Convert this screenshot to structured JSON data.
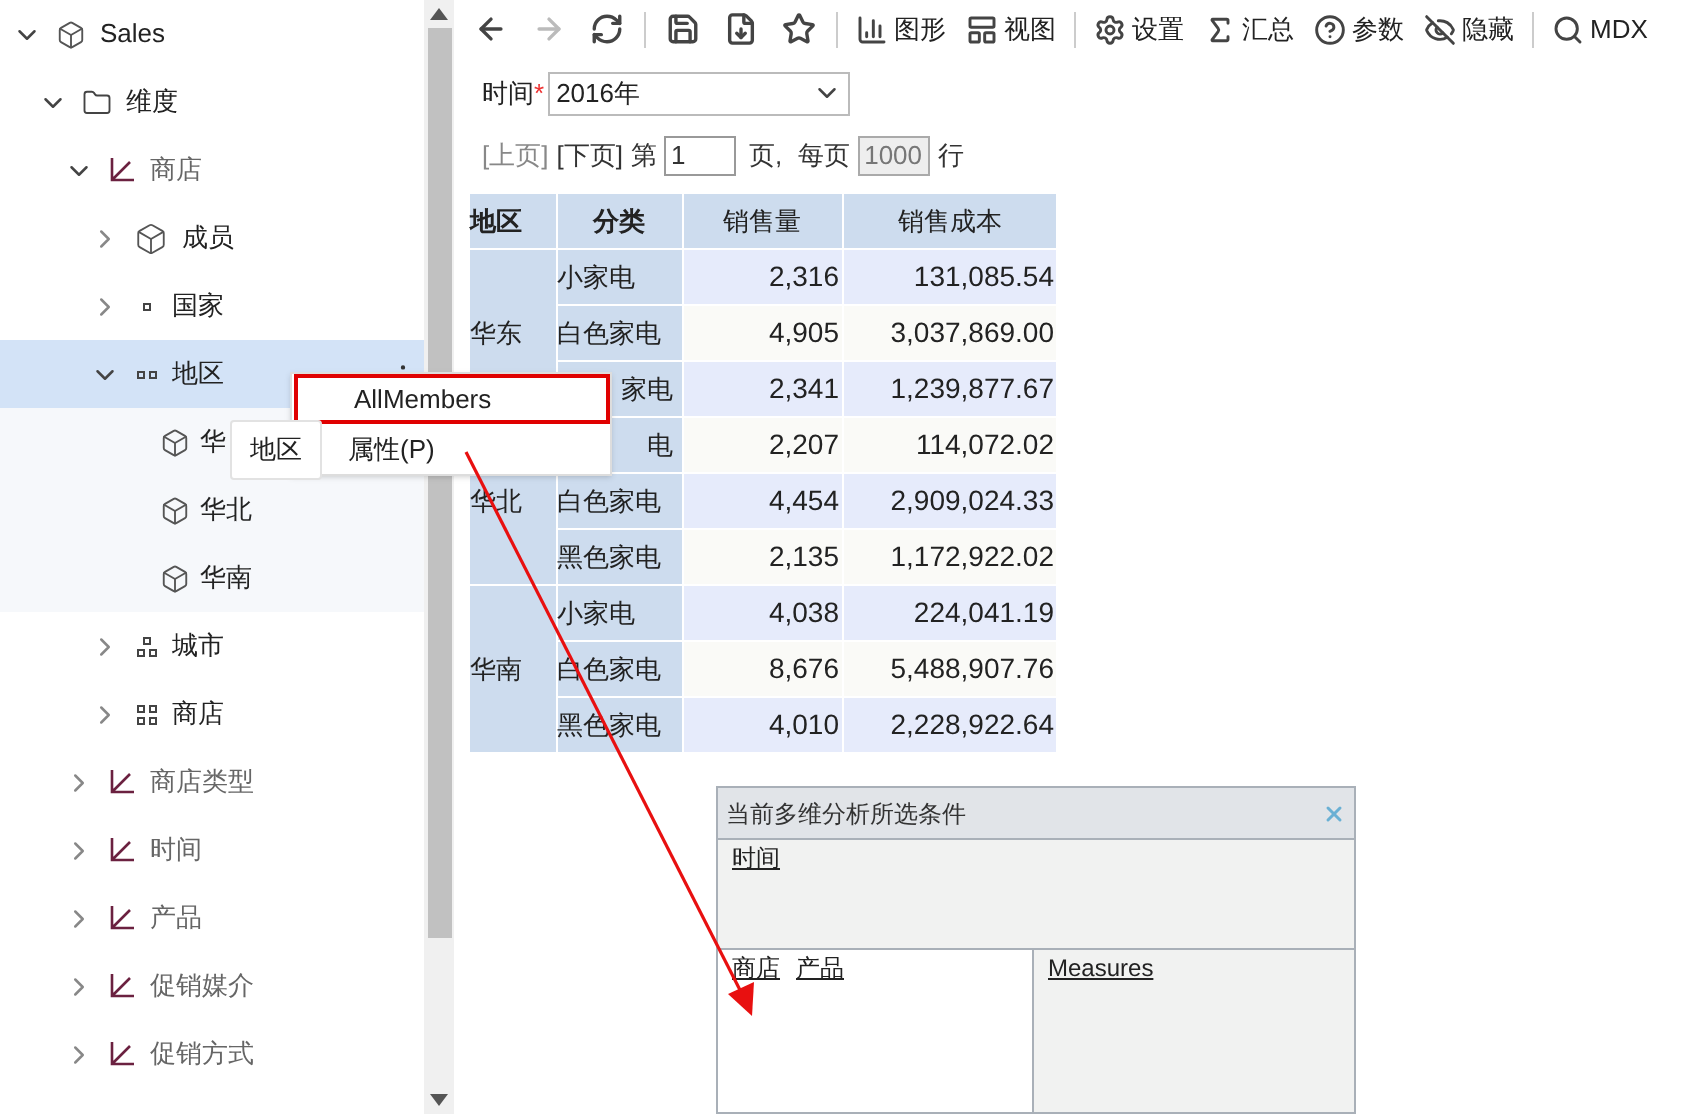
{
  "tree": [
    {
      "label": "Sales",
      "kind": "cube",
      "expanded": true,
      "children": [
        {
          "label": "维度",
          "kind": "folder",
          "expanded": true,
          "children": [
            {
              "label": "商店",
              "kind": "dimension",
              "expanded": true,
              "children": [
                {
                  "label": "成员",
                  "kind": "members",
                  "expanded": false
                },
                {
                  "label": "国家",
                  "kind": "level1",
                  "expanded": false
                },
                {
                  "label": "地区",
                  "kind": "level2",
                  "expanded": true,
                  "selected": true,
                  "children": [
                    {
                      "label": "华",
                      "kind": "member"
                    },
                    {
                      "label": "华北",
                      "kind": "member"
                    },
                    {
                      "label": "华南",
                      "kind": "member"
                    }
                  ]
                },
                {
                  "label": "城市",
                  "kind": "level3",
                  "expanded": false
                },
                {
                  "label": "商店",
                  "kind": "level4",
                  "expanded": false
                }
              ]
            },
            {
              "label": "商店类型",
              "kind": "dimension",
              "expanded": false
            },
            {
              "label": "时间",
              "kind": "dimension",
              "expanded": false
            },
            {
              "label": "产品",
              "kind": "dimension",
              "expanded": false
            },
            {
              "label": "促销媒介",
              "kind": "dimension",
              "expanded": false
            },
            {
              "label": "促销方式",
              "kind": "dimension",
              "expanded": false
            }
          ]
        }
      ]
    }
  ],
  "context_menu": {
    "items": [
      {
        "label": "AllMembers",
        "selected": true
      },
      {
        "label": "属性(P)",
        "selected": false
      }
    ],
    "tooltip": "地区"
  },
  "toolbar": [
    {
      "kind": "back",
      "disabled": false
    },
    {
      "kind": "forward",
      "disabled": true
    },
    {
      "kind": "refresh",
      "disabled": false
    },
    {
      "kind": "sep"
    },
    {
      "kind": "save",
      "disabled": false
    },
    {
      "kind": "saveas",
      "disabled": false
    },
    {
      "kind": "star",
      "disabled": false
    },
    {
      "kind": "sep"
    },
    {
      "kind": "chart",
      "label": "图形",
      "disabled": false
    },
    {
      "kind": "view",
      "label": "视图",
      "disabled": false
    },
    {
      "kind": "sep"
    },
    {
      "kind": "settings",
      "label": "设置",
      "disabled": false
    },
    {
      "kind": "sum",
      "label": "汇总",
      "disabled": false
    },
    {
      "kind": "help",
      "label": "参数",
      "disabled": false
    },
    {
      "kind": "hide",
      "label": "隐藏",
      "disabled": false
    },
    {
      "kind": "sep"
    },
    {
      "kind": "search",
      "label": "MDX",
      "disabled": false
    }
  ],
  "filter": {
    "label": "时间",
    "required_mark": "*",
    "value": "2016年"
  },
  "paging": {
    "prev": "[上页]",
    "next": "[下页]",
    "page_label": "第",
    "page": "1",
    "page_unit": "页,",
    "per_page_label": "每页",
    "per_page": "1000",
    "rows_unit": "行"
  },
  "table": {
    "columns": [
      "地区",
      "分类",
      "销售量",
      "销售成本"
    ],
    "groups": [
      {
        "region": "华东",
        "rows": [
          {
            "category": "小家电",
            "qty": "2,316",
            "cost": "131,085.54"
          },
          {
            "category": "白色家电",
            "qty": "4,905",
            "cost": "3,037,869.00"
          },
          {
            "category": "家电",
            "covered": true,
            "qty": "2,341",
            "cost": "1,239,877.67"
          }
        ]
      },
      {
        "region": "华北",
        "rows": [
          {
            "category": "电",
            "covered": true,
            "qty": "2,207",
            "cost": "114,072.02"
          },
          {
            "category": "白色家电",
            "qty": "4,454",
            "cost": "2,909,024.33"
          },
          {
            "category": "黑色家电",
            "qty": "2,135",
            "cost": "1,172,922.02"
          }
        ]
      },
      {
        "region": "华南",
        "rows": [
          {
            "category": "小家电",
            "qty": "4,038",
            "cost": "224,041.19"
          },
          {
            "category": "白色家电",
            "qty": "8,676",
            "cost": "5,488,907.76"
          },
          {
            "category": "黑色家电",
            "qty": "4,010",
            "cost": "2,228,922.64"
          }
        ]
      }
    ]
  },
  "conditions": {
    "title": "当前多维分析所选条件",
    "filters": [
      "时间"
    ],
    "rows": [
      "商店",
      "产品"
    ],
    "columns": [
      "Measures"
    ]
  }
}
